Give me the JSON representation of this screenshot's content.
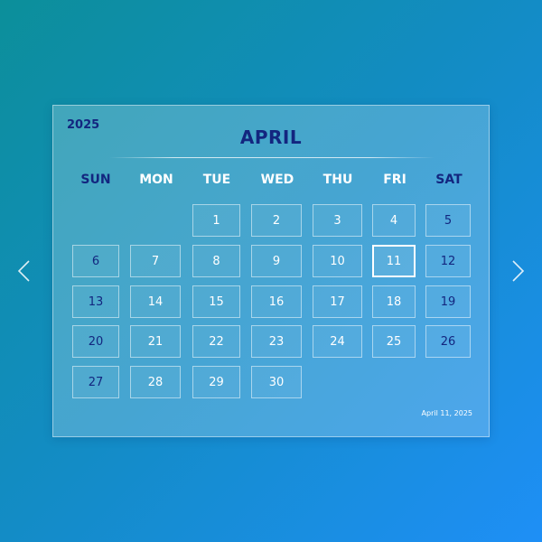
{
  "calendar": {
    "year": "2025",
    "month": "APRIL",
    "weekdays": [
      "SUN",
      "MON",
      "TUE",
      "WED",
      "THU",
      "FRI",
      "SAT"
    ],
    "days": [
      "1",
      "2",
      "3",
      "4",
      "5",
      "6",
      "7",
      "8",
      "9",
      "10",
      "11",
      "12",
      "13",
      "14",
      "15",
      "16",
      "17",
      "18",
      "19",
      "20",
      "21",
      "22",
      "23",
      "24",
      "25",
      "26",
      "27",
      "28",
      "29",
      "30"
    ],
    "today": "11",
    "selected_date": "April 11, 2025"
  },
  "icons": {
    "prev": "chevron-left-icon",
    "next": "chevron-right-icon"
  },
  "colors": {
    "accent": "#13267f",
    "text": "#ffffff",
    "background_start": "#0c8f9a",
    "background_end": "#1e8ff6"
  }
}
